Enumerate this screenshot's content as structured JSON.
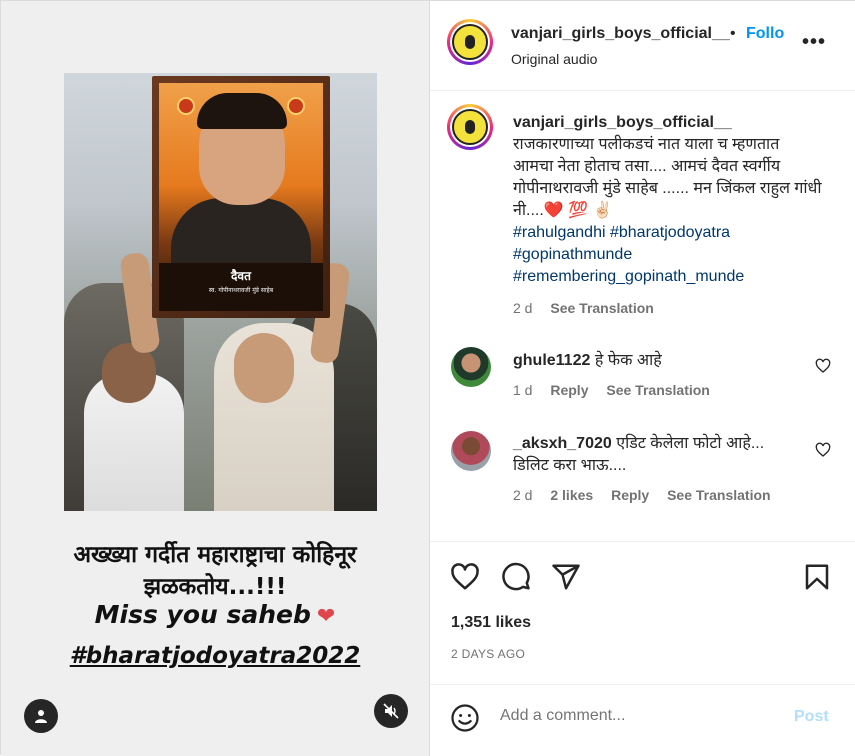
{
  "media": {
    "portrait_plaque_title": "दैवत",
    "portrait_plaque_subtitle": "स्व. गोपीनाथरावजी मुंडे साहेब",
    "caption_line1": "अख्ख्या गर्दीत महाराष्ट्राचा कोहिनूर",
    "caption_line2": "झळकतोय...!!!",
    "caption_line3": "Miss you saheb",
    "caption_line3_emoji": "❤",
    "caption_line4": "#bharatjodoyatra2022"
  },
  "header": {
    "username": "vanjari_girls_boys_official__",
    "separator": "•",
    "follow_label": "Follow",
    "subtitle": "Original audio",
    "more_label": "•••"
  },
  "post_caption": {
    "username": "vanjari_girls_boys_official__",
    "text": "राजकारणाच्या पलीकडचं नात याला च म्हणतात आमचा नेता होताच तसा.... आमचं दैवत स्वर्गीय गोपीनाथरावजी मुंडे साहेब ...... मन जिंकल राहुल गांधी नी....❤️ 💯 ✌🏻",
    "hashtags": [
      "#rahulgandhi #bharatjodoyatra",
      "#gopinathmunde",
      "#remembering_gopinath_munde"
    ],
    "time": "2 d",
    "see_translation": "See Translation"
  },
  "comments": [
    {
      "username": "ghule1122",
      "text": "हे फेक आहे",
      "time": "1 d",
      "reply": "Reply",
      "see_translation": "See Translation"
    },
    {
      "username": "_aksxh_7020",
      "text": "एडिट केलेला फोटो आहे... डिलिट करा भाऊ....",
      "time": "2 d",
      "likes": "2 likes",
      "reply": "Reply",
      "see_translation": "See Translation"
    }
  ],
  "likes": "1,351 likes",
  "posted_ago": "2 DAYS AGO",
  "composer": {
    "placeholder": "Add a comment...",
    "post_label": "Post"
  }
}
